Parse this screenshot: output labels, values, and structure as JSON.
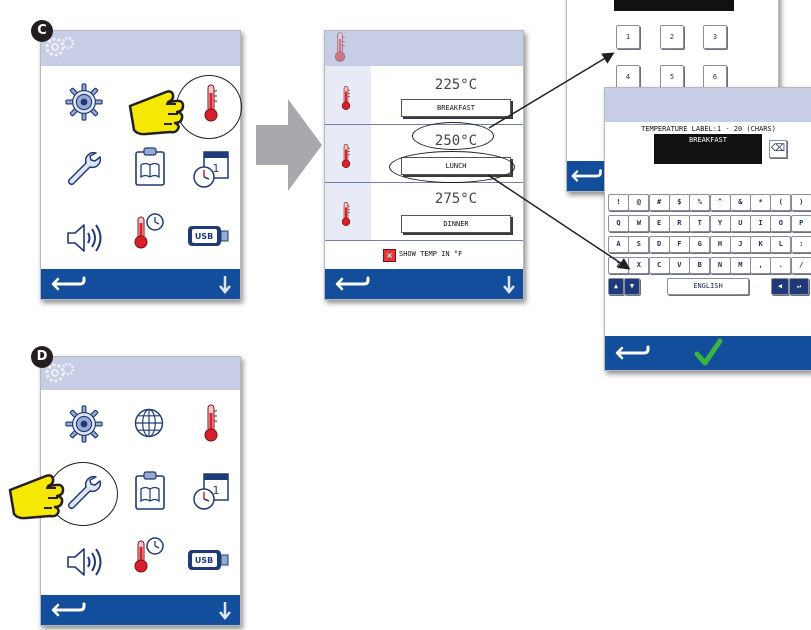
{
  "badges": {
    "c": "C",
    "d": "D"
  },
  "temp_screen": {
    "rows": [
      {
        "temp": "225°C",
        "label": "BREAKFAST"
      },
      {
        "temp": "250°C",
        "label": "LUNCH"
      },
      {
        "temp": "275°C",
        "label": "DINNER"
      }
    ],
    "checkbox_label": "SHOW TEMP IN °F"
  },
  "numpad": {
    "keys": [
      "1",
      "2",
      "3",
      "4",
      "5",
      "6"
    ]
  },
  "keyboard_screen": {
    "prompt": "TEMPERATURE LABEL:1 - 20 (CHARS)",
    "entry": "BREAKFAST",
    "row1": [
      "!",
      "@",
      "#",
      "$",
      "%",
      "^",
      "&",
      "*",
      "(",
      ")"
    ],
    "row2": [
      "Q",
      "W",
      "E",
      "R",
      "T",
      "Y",
      "U",
      "I",
      "O",
      "P"
    ],
    "row3": [
      "A",
      "S",
      "D",
      "F",
      "G",
      "H",
      "J",
      "K",
      "L",
      ":"
    ],
    "row4": [
      "Z",
      "X",
      "C",
      "V",
      "B",
      "N",
      "M",
      ",",
      ".",
      "/"
    ],
    "language": "ENGLISH"
  },
  "icons": {
    "usb_label": "USB"
  },
  "colors": {
    "header": "#c6cde4",
    "footer": "#124e9b",
    "accent_green": "#3cb33c",
    "hand_yellow": "#f6e805",
    "thermo_red": "#d7202a"
  }
}
